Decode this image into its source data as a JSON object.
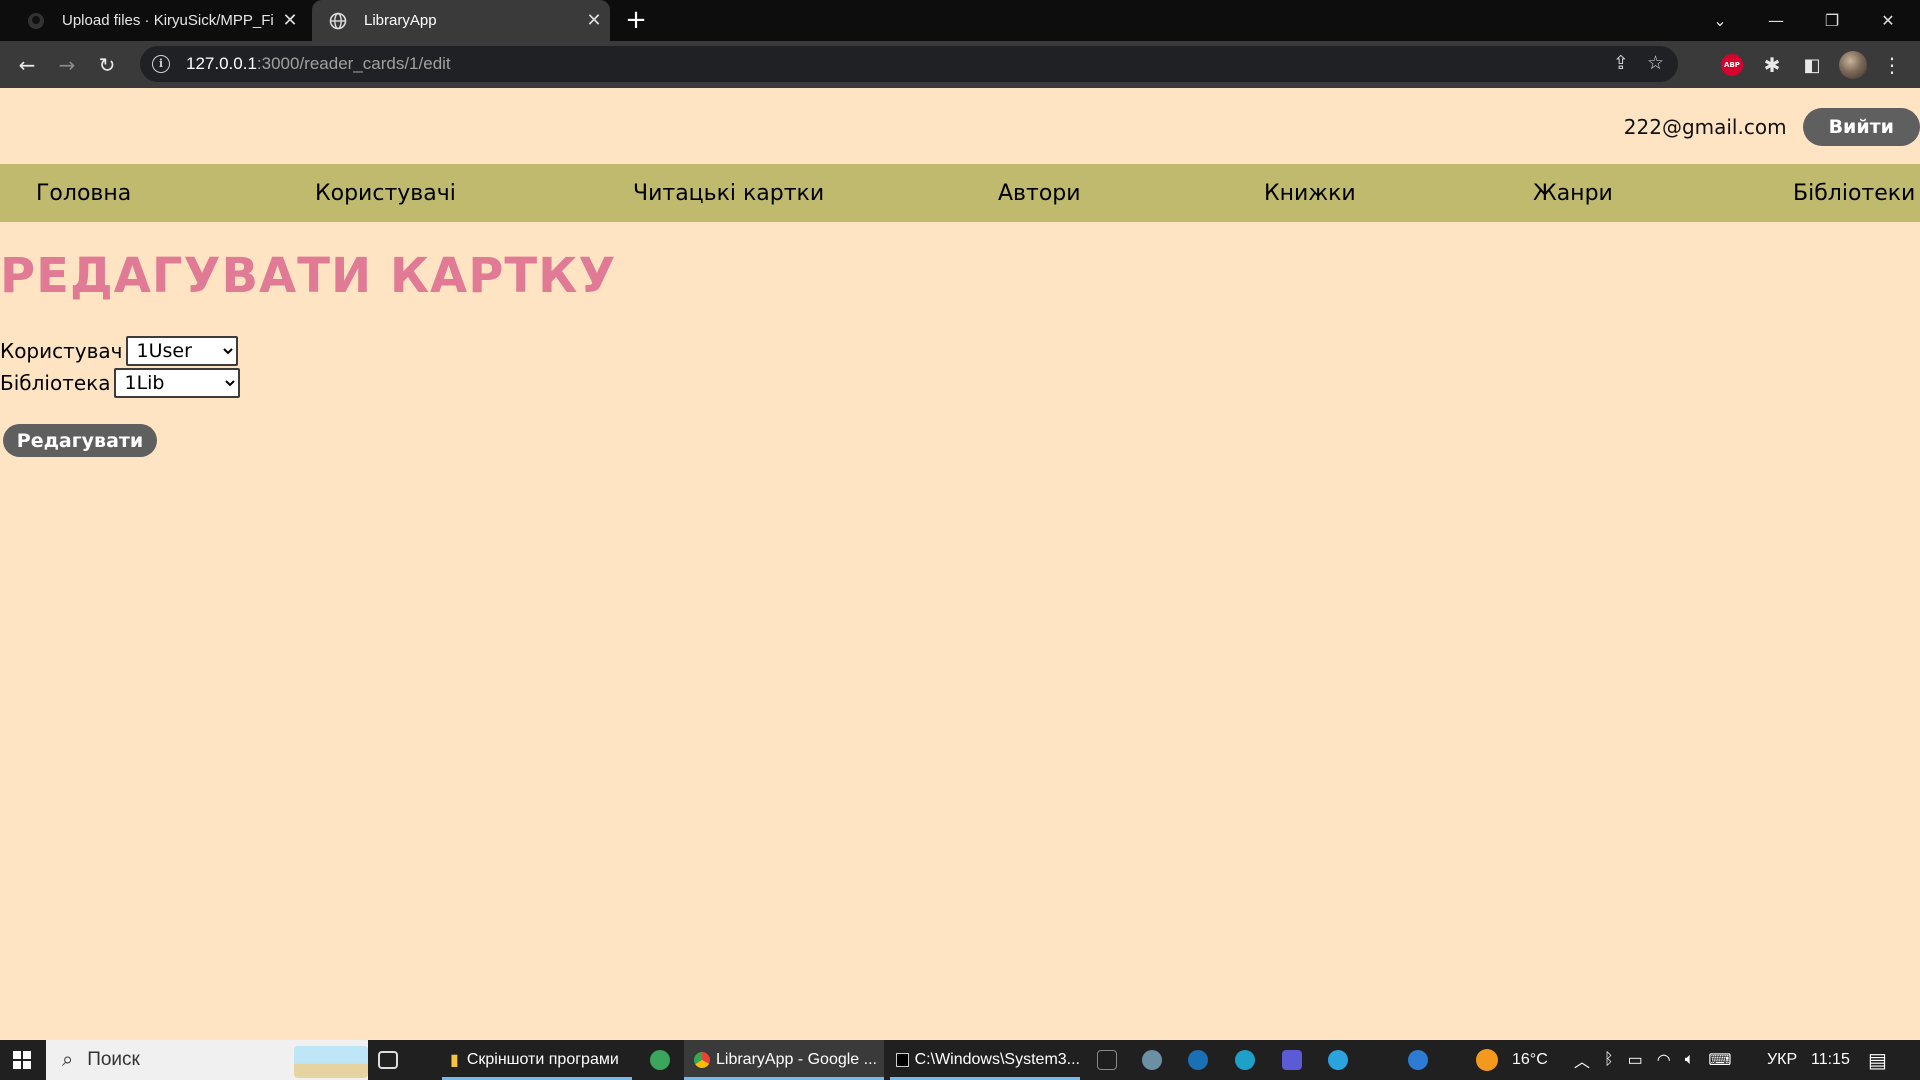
{
  "browser": {
    "tabs": [
      {
        "title": "Upload files · KiryuSick/MPP_Fin...",
        "active": false,
        "icon": "github-icon"
      },
      {
        "title": "LibraryApp",
        "active": true,
        "icon": "globe-icon"
      }
    ],
    "address": {
      "host": "127.0.0.1",
      "path": ":3000/reader_cards/1/edit"
    },
    "extensions": [
      "share-icon",
      "star-icon",
      "adblock-icon",
      "puzzle-icon",
      "sidepanel-icon",
      "profile-avatar",
      "kebab-menu-icon"
    ],
    "abp_label": "ABP"
  },
  "header": {
    "email": "222@gmail.com",
    "logout_label": "Вийти"
  },
  "nav": {
    "items": [
      "Головна",
      "Користувачі",
      "Читацькі картки",
      "Автори",
      "Книжки",
      "Жанри",
      "Бібліотеки"
    ]
  },
  "page": {
    "title": "РЕДАГУВАТИ КАРТКУ",
    "user_label": "Користувач",
    "user_value": "1User",
    "library_label": "Бібліотека",
    "library_value": "1Lib",
    "submit_label": "Редагувати"
  },
  "taskbar": {
    "search_placeholder": "Поиск",
    "apps": [
      {
        "label": "Скріншоти програми",
        "icon": "folder-icon"
      },
      {
        "label": "LibraryApp - Google ...",
        "icon": "chrome-icon"
      },
      {
        "label": "C:\\Windows\\System3...",
        "icon": "cmd-icon"
      }
    ],
    "weather": "16°C",
    "lang": "УКР",
    "time": "11:15"
  },
  "colors": {
    "page_bg": "#ffe4c4",
    "nav_bg": "#bfba6e",
    "title": "#e07a95",
    "button": "#5f5f5f"
  }
}
